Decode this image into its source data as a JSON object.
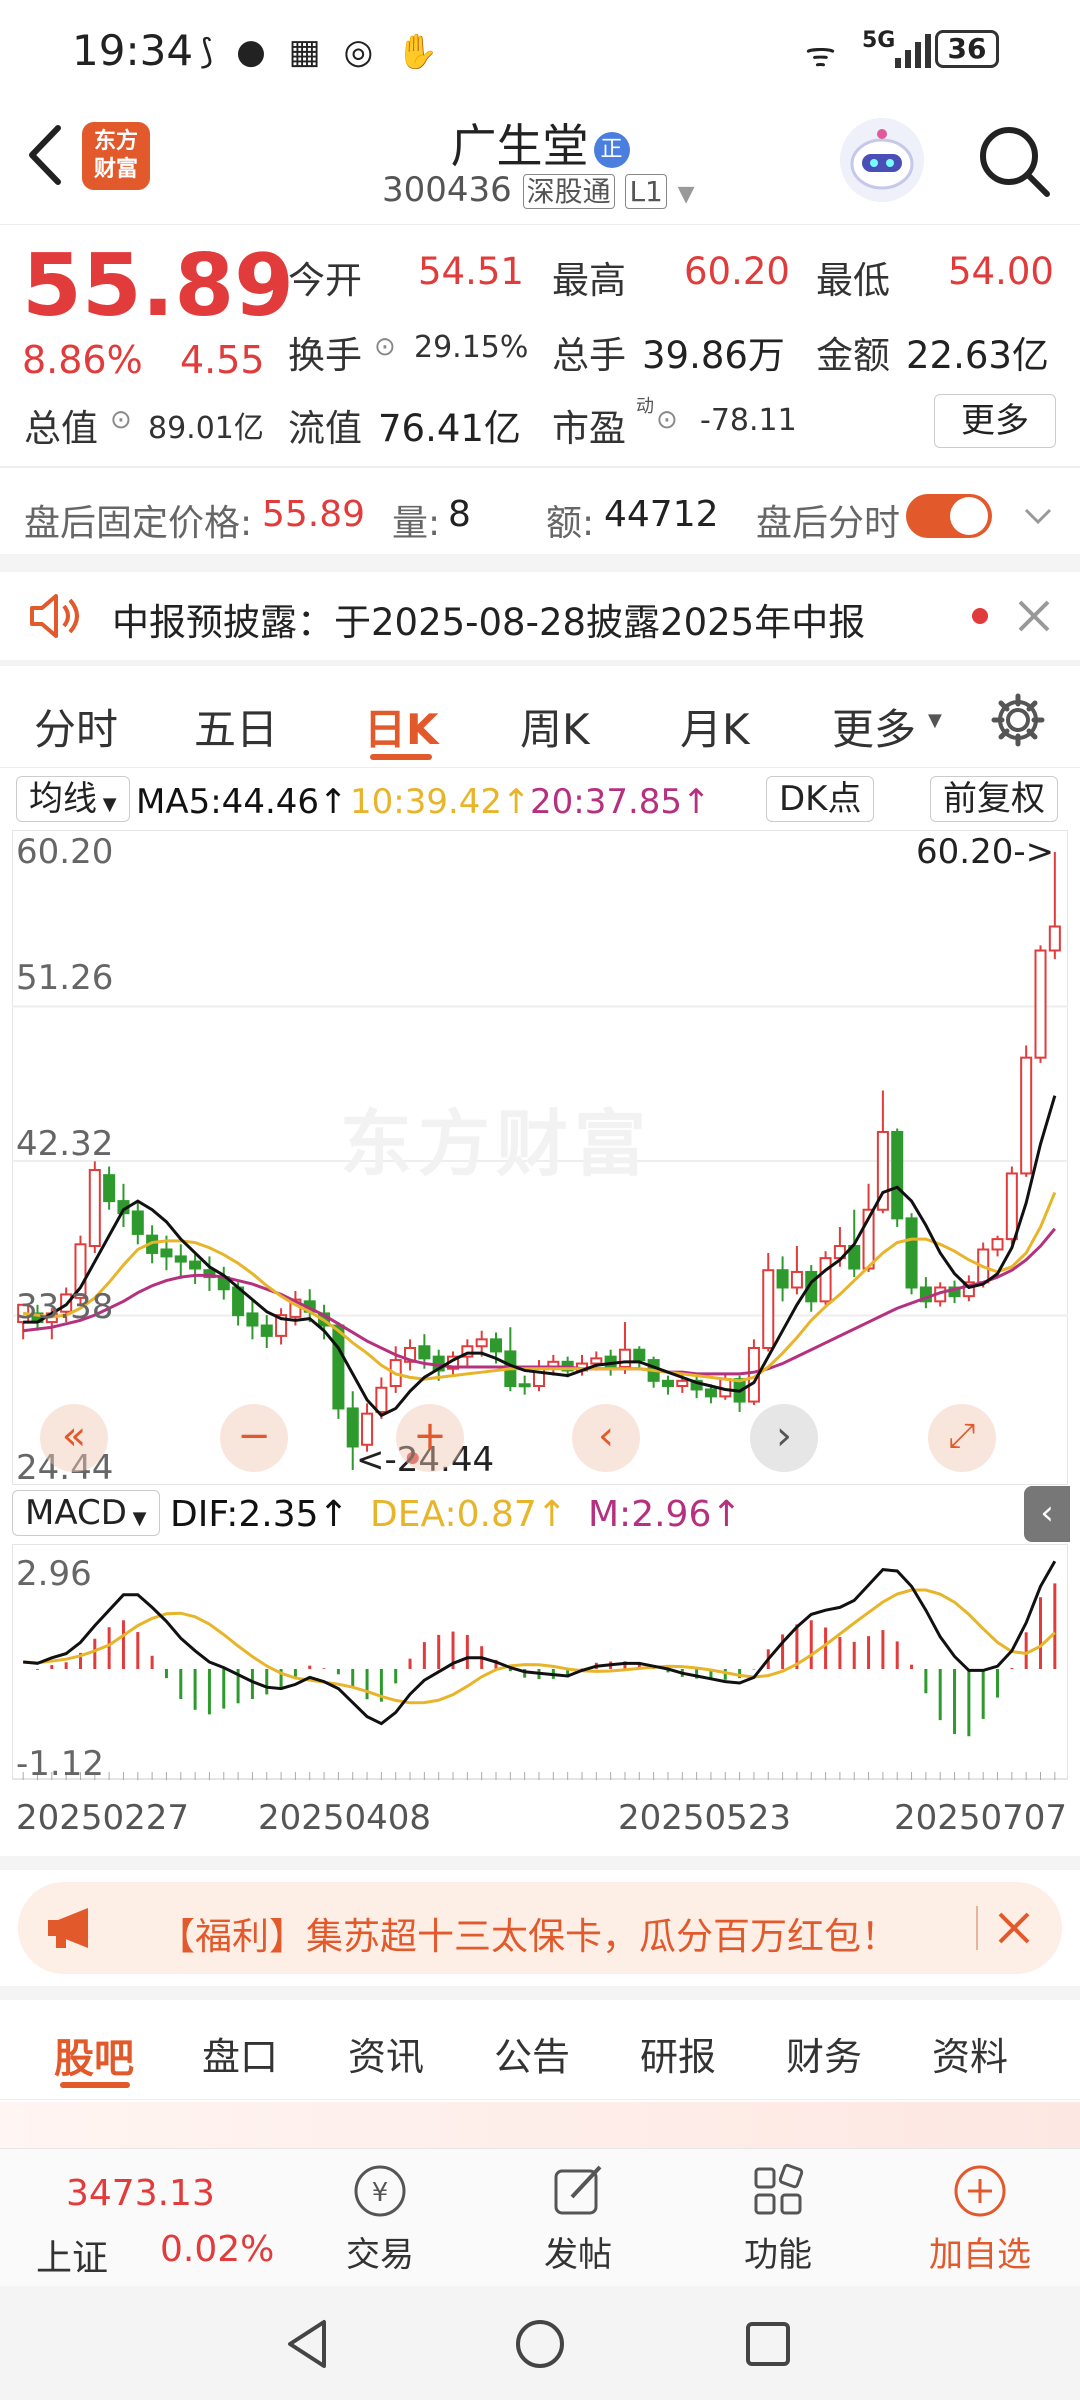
{
  "status": {
    "time": "19:34",
    "network": "5G",
    "battery": "36"
  },
  "header": {
    "back": "back",
    "logo": "东方\n财富",
    "name": "广生堂",
    "badge": "正",
    "code": "300436",
    "exchange": "深股通",
    "level": "L1"
  },
  "quote": {
    "price": "55.89",
    "pct": "8.86%",
    "chg": "4.55",
    "open_label": "今开",
    "open": "54.51",
    "high_label": "最高",
    "high": "60.20",
    "low_label": "最低",
    "low": "54.00",
    "turnover_label": "换手",
    "turnover": "29.15%",
    "vol_label": "总手",
    "vol": "39.86万",
    "amount_label": "金额",
    "amount": "22.63亿",
    "mcap_label": "总值",
    "mcap": "89.01亿",
    "float_label": "流值",
    "float": "76.41亿",
    "pe_label": "市盈",
    "pe_sup": "动",
    "pe": "-78.11",
    "more": "更多"
  },
  "afterhours": {
    "price_label": "盘后固定价格:",
    "price": "55.89",
    "vol_label": "量:",
    "vol": "8",
    "amt_label": "额:",
    "amt": "44712",
    "toggle_label": "盘后分时",
    "toggle_on": true
  },
  "notice": {
    "text": "中报预披露：于2025-08-28披露2025年中报"
  },
  "kline_tabs": [
    "分时",
    "五日",
    "日K",
    "周K",
    "月K",
    "更多"
  ],
  "kline_tab_active": 2,
  "ma": {
    "selector": "均线",
    "ma5": "MA5:44.46↑",
    "ma10": "10:39.42↑",
    "ma20": "20:37.85↑",
    "dk": "DK点",
    "adjust": "前复权"
  },
  "price_axis": [
    "60.20",
    "51.26",
    "42.32",
    "33.38",
    "24.44"
  ],
  "hi_marker": "60.20->",
  "lo_marker": "<-24.44",
  "macd": {
    "selector": "MACD",
    "dif": "DIF:2.35↑",
    "dea": "DEA:0.87↑",
    "m": "M:2.96↑",
    "top": "2.96",
    "bottom": "-1.12"
  },
  "dates": [
    "20250227",
    "20250408",
    "20250523",
    "20250707"
  ],
  "colors": {
    "up": "#e23b3b",
    "down": "#2e9a2e",
    "ma5": "#111111",
    "ma10": "#e8b429",
    "ma20": "#b5317f",
    "accent": "#e2592b"
  },
  "chart_data": {
    "type": "candlestick",
    "ylim": [
      24.44,
      60.2
    ],
    "candles": [
      [
        33,
        34,
        32,
        33.5
      ],
      [
        33.5,
        33,
        32.5,
        34
      ],
      [
        33,
        33.5,
        32,
        33.8
      ],
      [
        33.6,
        34.6,
        33,
        35
      ],
      [
        34.4,
        37.5,
        34,
        38
      ],
      [
        37.4,
        41.8,
        37,
        42.3
      ],
      [
        41.5,
        40,
        39.5,
        42
      ],
      [
        40,
        39.3,
        38.5,
        41
      ],
      [
        39.4,
        38.1,
        37.5,
        40
      ],
      [
        38,
        37,
        36.4,
        38.6
      ],
      [
        37.2,
        36.8,
        36,
        38
      ],
      [
        36.8,
        36.5,
        35.5,
        37.5
      ],
      [
        36.5,
        36.1,
        35.2,
        37
      ],
      [
        36,
        35.6,
        34.8,
        36.8
      ],
      [
        35.6,
        34.9,
        34.3,
        36.2
      ],
      [
        35,
        33.4,
        32.8,
        35.3
      ],
      [
        33.5,
        32.8,
        32,
        34.3
      ],
      [
        32.8,
        32.2,
        31.5,
        33.4
      ],
      [
        32.2,
        33.4,
        31.7,
        33.8
      ],
      [
        33.3,
        34.3,
        32.8,
        34.8
      ],
      [
        34.2,
        33.6,
        33,
        34.9
      ],
      [
        33.5,
        32.8,
        32,
        34
      ],
      [
        32.8,
        28,
        27.4,
        33
      ],
      [
        28,
        25.8,
        24.44,
        29
      ],
      [
        25.9,
        27.7,
        25.5,
        28.3
      ],
      [
        27.8,
        29.2,
        27.4,
        29.8
      ],
      [
        29.3,
        30.8,
        28.9,
        31.6
      ],
      [
        30.7,
        31.5,
        30.2,
        32
      ],
      [
        31.6,
        30.9,
        30.3,
        32.3
      ],
      [
        31,
        30.2,
        29.6,
        31.4
      ],
      [
        30.3,
        31,
        29.9,
        31.3
      ],
      [
        31,
        31.6,
        30.4,
        32
      ],
      [
        31.6,
        32,
        31,
        32.5
      ],
      [
        32,
        31.3,
        30.6,
        32.4
      ],
      [
        31.3,
        29.3,
        29,
        32.7
      ],
      [
        29.4,
        29.3,
        28.8,
        29.9
      ],
      [
        29.3,
        30.3,
        29,
        30.8
      ],
      [
        30.3,
        30.7,
        29.9,
        31.1
      ],
      [
        30.7,
        30.2,
        29.8,
        31
      ],
      [
        30.2,
        30.6,
        29.9,
        31.1
      ],
      [
        30.6,
        30.9,
        30.2,
        31.3
      ],
      [
        31,
        30.4,
        29.9,
        31.4
      ],
      [
        30.4,
        31.4,
        30,
        33
      ],
      [
        31.4,
        30.8,
        30.3,
        31.6
      ],
      [
        30.8,
        29.6,
        29.2,
        31
      ],
      [
        29.6,
        29.3,
        28.8,
        29.9
      ],
      [
        29.3,
        29.6,
        28.9,
        30.1
      ],
      [
        29.6,
        29.1,
        28.6,
        29.9
      ],
      [
        29.1,
        28.7,
        28.3,
        29.4
      ],
      [
        28.7,
        29.7,
        28.5,
        30
      ],
      [
        29.7,
        28.4,
        27.8,
        29.9
      ],
      [
        28.4,
        31.5,
        28.2,
        32
      ],
      [
        31.5,
        36,
        31.3,
        37
      ],
      [
        36,
        35,
        34.2,
        36.8
      ],
      [
        35,
        35.9,
        34.6,
        37.4
      ],
      [
        35.9,
        34.2,
        33.6,
        36.3
      ],
      [
        34.2,
        36.7,
        34,
        37.1
      ],
      [
        36.7,
        37.4,
        36.2,
        38.5
      ],
      [
        37.4,
        36.1,
        35.6,
        39.5
      ],
      [
        36.1,
        39.5,
        35.9,
        41
      ],
      [
        39.5,
        44,
        39.3,
        46.4
      ],
      [
        44,
        39,
        38.5,
        44.2
      ],
      [
        39,
        35,
        34.6,
        39.3
      ],
      [
        35,
        34.2,
        33.8,
        35.6
      ],
      [
        34.2,
        35,
        33.9,
        35.3
      ],
      [
        35,
        34.5,
        34.1,
        35.4
      ],
      [
        34.5,
        35.3,
        34.2,
        35.7
      ],
      [
        35.3,
        37.2,
        35,
        37.6
      ],
      [
        37.2,
        37.8,
        36.8,
        38
      ],
      [
        37.8,
        41.6,
        37.5,
        42
      ],
      [
        41.6,
        48.3,
        41.4,
        49
      ],
      [
        48.3,
        54.5,
        48,
        54.8
      ],
      [
        54.5,
        55.89,
        54,
        60.2
      ]
    ],
    "ma5": [
      33,
      33,
      33.5,
      34,
      35,
      36.5,
      38,
      39.5,
      40,
      39.5,
      38.8,
      37.8,
      37,
      36.2,
      35.7,
      35,
      34.3,
      33.6,
      33.2,
      33.1,
      33.2,
      32.5,
      31.5,
      30,
      28.5,
      27.6,
      28,
      29,
      29.8,
      30.3,
      30.8,
      31.2,
      31.2,
      30.9,
      30.5,
      30.2,
      30.1,
      30,
      29.9,
      30.2,
      30.5,
      30.6,
      30.7,
      30.7,
      30.4,
      30.1,
      29.8,
      29.5,
      29.3,
      29.1,
      29,
      29.5,
      31,
      32.5,
      34,
      35.3,
      36,
      36.6,
      37.5,
      39,
      40.5,
      40.8,
      40,
      38.6,
      37,
      35.8,
      35,
      35.2,
      35.8,
      37.3,
      39.9,
      43.3,
      46.1
    ],
    "ma10": [
      33.5,
      33.4,
      33.3,
      33.4,
      33.8,
      34.4,
      35.3,
      36.3,
      37.2,
      37.6,
      37.7,
      37.7,
      37.6,
      37.3,
      36.9,
      36.4,
      35.8,
      35.1,
      34.5,
      34,
      33.6,
      33.1,
      32.5,
      31.8,
      31.2,
      30.5,
      30,
      29.8,
      29.7,
      29.8,
      29.9,
      30,
      30.1,
      30.2,
      30.3,
      30.3,
      30.3,
      30.3,
      30.3,
      30.3,
      30.3,
      30.3,
      30.3,
      30.3,
      30.2,
      30.1,
      30,
      29.9,
      29.8,
      29.7,
      29.6,
      29.8,
      30.4,
      31.2,
      32.1,
      33.1,
      33.9,
      34.6,
      35.4,
      36.2,
      37,
      37.6,
      37.8,
      37.8,
      37.5,
      37.1,
      36.6,
      36.2,
      35.9,
      36.2,
      37,
      38.5,
      40.5
    ],
    "ma20": [
      32.5,
      32.6,
      32.7,
      32.9,
      33.1,
      33.4,
      33.8,
      34.2,
      34.7,
      35.1,
      35.4,
      35.6,
      35.7,
      35.7,
      35.6,
      35.4,
      35.2,
      34.9,
      34.6,
      34.2,
      33.8,
      33.4,
      32.9,
      32.4,
      31.9,
      31.5,
      31.1,
      30.8,
      30.6,
      30.5,
      30.4,
      30.4,
      30.4,
      30.4,
      30.4,
      30.4,
      30.4,
      30.4,
      30.4,
      30.3,
      30.3,
      30.3,
      30.3,
      30.3,
      30.2,
      30.1,
      30.1,
      30,
      30,
      30,
      30,
      30.1,
      30.3,
      30.6,
      31,
      31.4,
      31.8,
      32.2,
      32.6,
      33,
      33.4,
      33.8,
      34.1,
      34.4,
      34.7,
      34.9,
      35.1,
      35.3,
      35.6,
      36,
      36.6,
      37.4,
      38.4
    ]
  },
  "promo": {
    "text": "【福利】集苏超十三太保卡，瓜分百万红包！"
  },
  "bottom_tabs": [
    "股吧",
    "盘口",
    "资讯",
    "公告",
    "研报",
    "财务",
    "资料"
  ],
  "bottom_tab_active": 0,
  "index": {
    "value": "3473.13",
    "name": "上证",
    "pct": "0.02%"
  },
  "actions": [
    "交易",
    "发帖",
    "功能",
    "加自选"
  ],
  "watermark": "东方财富"
}
